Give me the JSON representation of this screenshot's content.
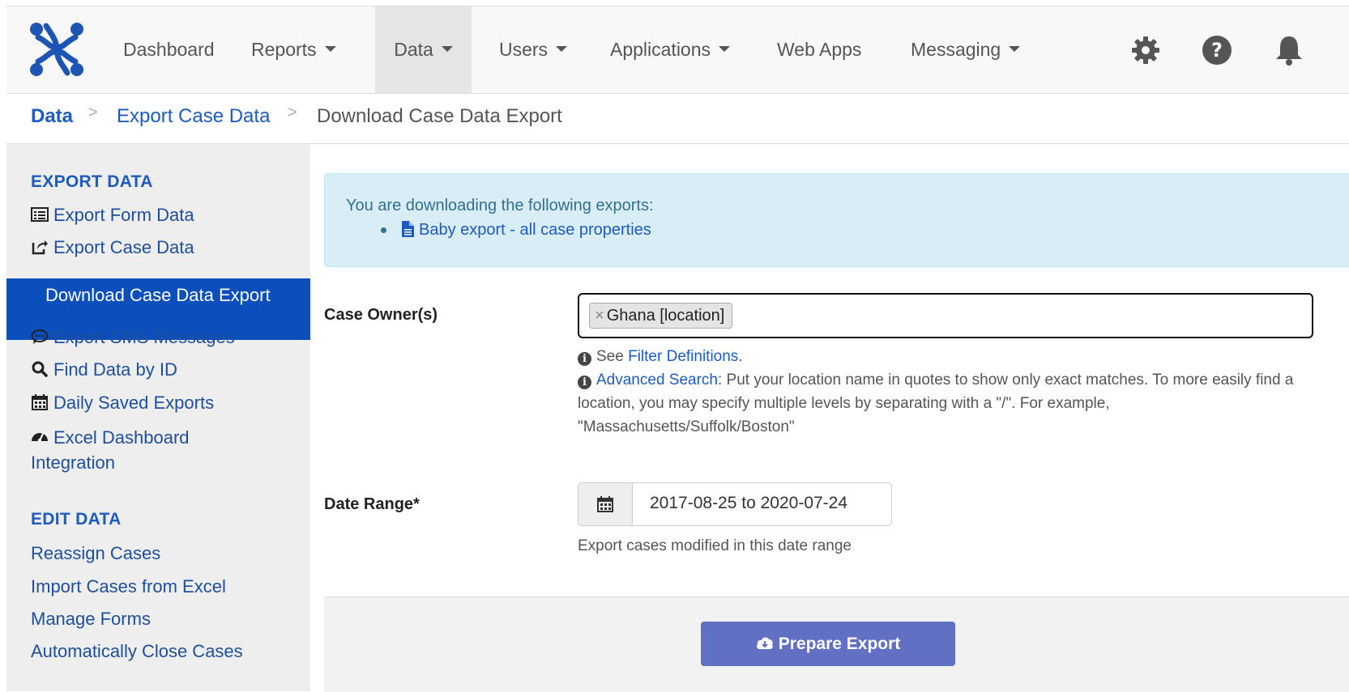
{
  "nav": {
    "items": [
      {
        "label": "Dashboard",
        "dropdown": false
      },
      {
        "label": "Reports",
        "dropdown": true
      },
      {
        "label": "Data",
        "dropdown": true,
        "active": true
      },
      {
        "label": "Users",
        "dropdown": true
      },
      {
        "label": "Applications",
        "dropdown": true
      },
      {
        "label": "Web Apps",
        "dropdown": false
      },
      {
        "label": "Messaging",
        "dropdown": true
      }
    ],
    "icons": [
      "gear-icon",
      "help-icon",
      "bell-icon"
    ]
  },
  "breadcrumb": {
    "root": "Data",
    "parent": "Export Case Data",
    "current": "Download Case Data Export",
    "separator": ">"
  },
  "sidebar": {
    "export_heading": "EXPORT DATA",
    "export_items": [
      {
        "label": "Export Form Data",
        "icon": "list-icon"
      },
      {
        "label": "Export Case Data",
        "icon": "share-icon"
      },
      {
        "label": "Download Case Data Export",
        "active": true
      },
      {
        "label": "Export SMS Messages",
        "icon": "comment-icon"
      },
      {
        "label": "Find Data by ID",
        "icon": "search-icon"
      },
      {
        "label": "Daily Saved Exports",
        "icon": "calendar-icon"
      },
      {
        "label": "Excel Dashboard Integration",
        "icon": "dashboard-icon"
      }
    ],
    "edit_heading": "EDIT DATA",
    "edit_items": [
      {
        "label": "Reassign Cases"
      },
      {
        "label": "Import Cases from Excel"
      },
      {
        "label": "Manage Forms"
      },
      {
        "label": "Automatically Close Cases"
      }
    ]
  },
  "alert": {
    "text": "You are downloading the following exports:",
    "export_name": "Baby export - all case properties"
  },
  "form": {
    "case_owner_label": "Case Owner(s)",
    "case_owner_tag": "Ghana [location]",
    "help_see": "See ",
    "help_filter_link": "Filter Definitions.",
    "help_adv_link": "Advanced Search:",
    "help_adv_text": " Put your location name in quotes to show only exact matches. To more easily find a location, you may specify multiple levels by separating with a \"/\". For example, \"Massachusetts/Suffolk/Boston\"",
    "date_range_label": "Date Range*",
    "date_range_value": "2017-08-25 to 2020-07-24",
    "date_help": "Export cases modified in this date range",
    "submit_label": "Prepare Export"
  },
  "colors": {
    "brand": "#0b4fbc",
    "link": "#1d5bbf",
    "button": "#6270c4",
    "alert_bg": "#d9edf7"
  }
}
